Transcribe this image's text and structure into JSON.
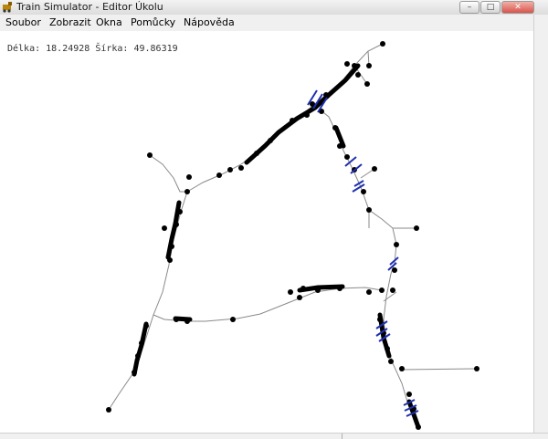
{
  "window": {
    "title": "Train Simulator - Editor Úkolu",
    "buttons": {
      "minimize": "–",
      "maximize": "□",
      "close": "✕"
    }
  },
  "menu": [
    {
      "label": "Soubor"
    },
    {
      "label": "Zobrazit"
    },
    {
      "label": "Okna"
    },
    {
      "label": "Pomůcky"
    },
    {
      "label": "Nápověda"
    }
  ],
  "coords": {
    "text": "Délka: 18.24928 Šírka: 49.86319"
  },
  "colors": {
    "track": "#8a8a8a",
    "station": "#000000",
    "signal": "#1e2fb0"
  },
  "icons": {
    "app": "locomotive-icon"
  }
}
